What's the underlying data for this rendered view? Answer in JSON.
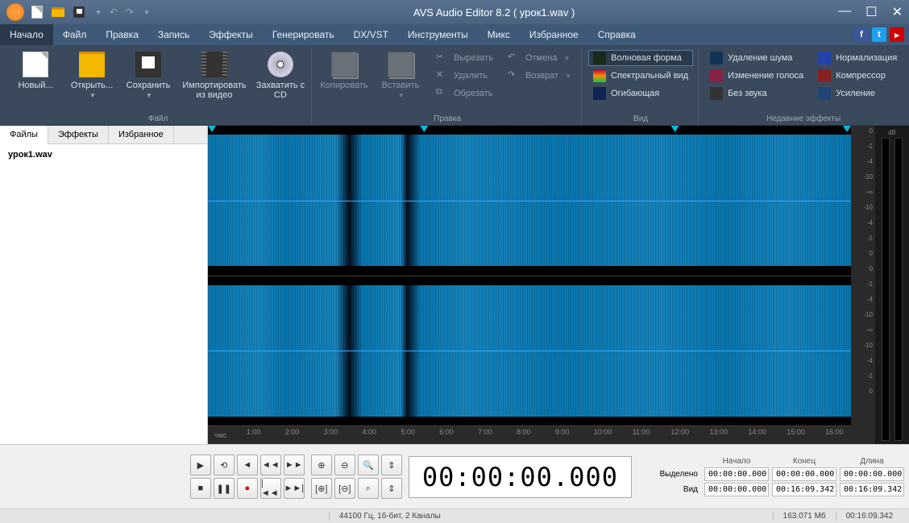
{
  "title": "AVS Audio Editor 8.2  ( урок1.wav )",
  "menu": [
    "Начало",
    "Файл",
    "Правка",
    "Запись",
    "Эффекты",
    "Генерировать",
    "DX/VST",
    "Инструменты",
    "Микс",
    "Избранное",
    "Справка"
  ],
  "ribbon": {
    "file": {
      "label": "Файл",
      "new": "Новый...",
      "open": "Открыть...",
      "save": "Сохранить",
      "import": "Импортировать из видео",
      "grab": "Захватить с CD"
    },
    "edit": {
      "label": "Правка",
      "copy": "Копировать",
      "paste": "Вставить",
      "cut": "Вырезать",
      "delete": "Удалить",
      "trim": "Обрезать",
      "undo": "Отмена",
      "redo": "Возврат"
    },
    "view": {
      "label": "Вид",
      "waveform": "Волновая форма",
      "spectral": "Спектральный вид",
      "envelope": "Огибающая"
    },
    "effects": {
      "label": "Недавние эффекты",
      "noise": "Удаление шума",
      "voice": "Изменение голоса",
      "mute": "Без звука",
      "norm": "Нормализация",
      "comp": "Компрессор",
      "amp": "Усиление"
    }
  },
  "tabs": [
    "Файлы",
    "Эффекты",
    "Избранное"
  ],
  "file_item": "урок1.wav",
  "timeline": {
    "unit": "чмс",
    "ticks": [
      "1:00",
      "2:00",
      "3:00",
      "4:00",
      "5:00",
      "6:00",
      "7:00",
      "8:00",
      "9:00",
      "10:00",
      "11:00",
      "12:00",
      "13:00",
      "14:00",
      "15:00",
      "16:00"
    ]
  },
  "db_label": "dB",
  "db_ticks": [
    "0",
    "-1",
    "-4",
    "-10",
    "-∞",
    "-10",
    "-4",
    "-1",
    "0"
  ],
  "time_display": "00:00:00.000",
  "sel": {
    "headers": [
      "Начало",
      "Конец",
      "Длина"
    ],
    "rows": [
      {
        "label": "Выделено",
        "start": "00:00:00.000",
        "end": "00:00:00.000",
        "len": "00:00:00.000"
      },
      {
        "label": "Вид",
        "start": "00:00:00.000",
        "end": "00:16:09.342",
        "len": "00:16:09.342"
      }
    ]
  },
  "status": {
    "format": "44100 Гц, 16-бит, 2 Каналы",
    "size": "163.071 Мб",
    "duration": "00:16:09.342"
  }
}
